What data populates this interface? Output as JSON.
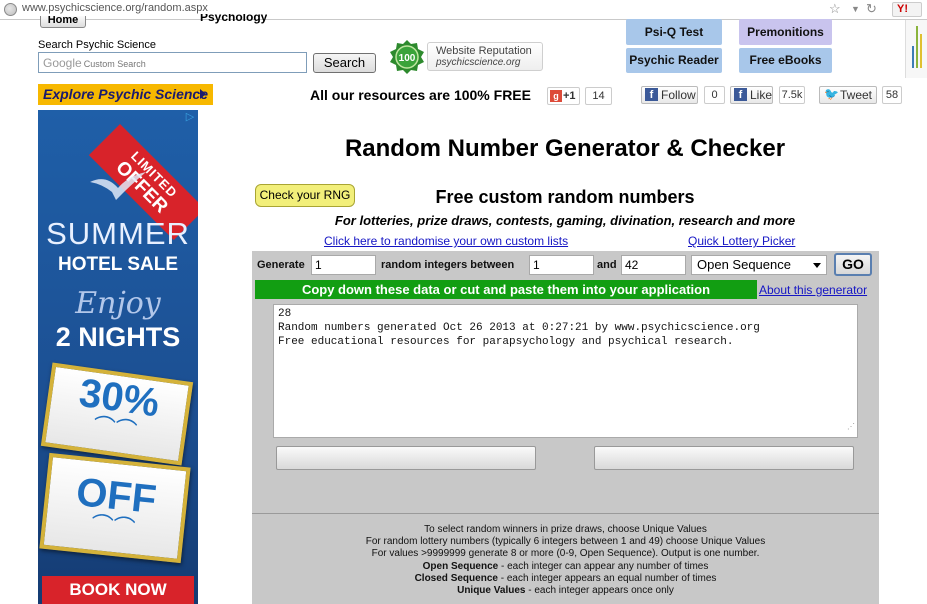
{
  "browser": {
    "url_host": "www.psychicscience.org",
    "url_path": "/random.aspx"
  },
  "header": {
    "home_label": "Home",
    "partial_nav": "Psychology",
    "search_label": "Search Psychic Science",
    "search_google": "Google",
    "search_placeholder": "Custom Search",
    "search_button": "Search",
    "rep_score": "100",
    "rep_title": "Website Reputation",
    "rep_site": "psychicscience.org",
    "nav_buttons": [
      "Psi-Q Test",
      "Premonitions",
      "Psychic Reader",
      "Free eBooks"
    ]
  },
  "social": {
    "explore": "Explore Psychic Science",
    "free_resources": "All our resources are 100% FREE",
    "gplus_label": "+1",
    "gplus_count": "14",
    "fb_follow": "Follow",
    "fb_follow_count": "0",
    "fb_like": "Like",
    "fb_like_count": "7.5k",
    "tweet": "Tweet",
    "tweet_count": "58"
  },
  "ad": {
    "limited": "LIMITED",
    "offer": "OFFER",
    "summer": "SUMMER",
    "hotel_sale": "HOTEL SALE",
    "enjoy": "Enjoy",
    "nights": "2 NIGHTS",
    "pct": "30%",
    "off": "OFF",
    "book_now": "BOOK NOW"
  },
  "main": {
    "title": "Random Number Generator & Checker",
    "check_rng": "Check your RNG",
    "free_custom": "Free custom random numbers",
    "subtitle": "For lotteries, prize draws, contests, gaming, divination, research and more",
    "link_custom_lists": "Click here to randomise your own custom lists",
    "link_lottery": "Quick Lottery Picker"
  },
  "generator": {
    "generate_label": "Generate",
    "count_value": "1",
    "between_label": "random integers between",
    "min_value": "1",
    "and_label": "and",
    "max_value": "42",
    "mode_selected": "Open Sequence",
    "go_button": "GO",
    "copy_bar": "Copy down these data or cut and paste them into your application",
    "about_link": "About this generator",
    "output_lines": [
      "28",
      "",
      "Random numbers generated Oct 26 2013 at 0:27:21 by www.psychicscience.org",
      "Free educational resources for parapsychology and psychical research."
    ]
  },
  "info": {
    "line1": "To select random winners in prize draws, choose Unique Values",
    "line2": "For random lottery numbers (typically 6 integers between 1 and 49) choose Unique Values",
    "line3": "For values >9999999 generate 8 or more (0-9, Open Sequence). Output is one number.",
    "open_term": "Open Sequence",
    "open_desc": " - each integer can appear any number of times",
    "closed_term": "Closed Sequence",
    "closed_desc": " - each integer appears an equal number of times",
    "unique_term": "Unique Values",
    "unique_desc": " - each integer appears once only"
  }
}
